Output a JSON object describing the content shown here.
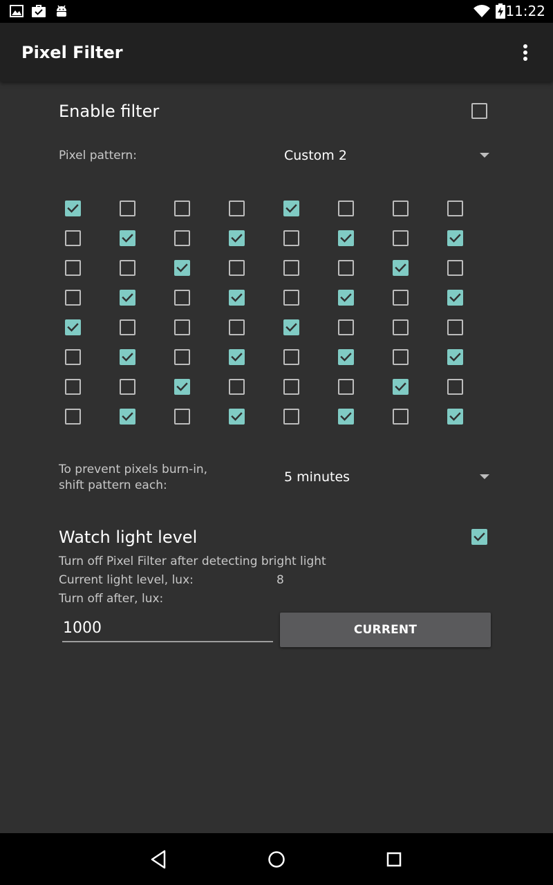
{
  "status_bar": {
    "time": "11:22",
    "left_icons": [
      "image-icon",
      "briefcase-check-icon",
      "android-icon"
    ],
    "right_icons": [
      "wifi-icon",
      "battery-charging-icon"
    ]
  },
  "app_bar": {
    "title": "Pixel Filter",
    "overflow_icon": "more-vert-icon"
  },
  "enable_filter": {
    "label": "Enable filter",
    "checked": false
  },
  "pixel_pattern": {
    "label": "Pixel pattern:",
    "selected": "Custom 2"
  },
  "pattern_grid": [
    [
      true,
      false,
      false,
      false,
      true,
      false,
      false,
      false
    ],
    [
      false,
      true,
      false,
      true,
      false,
      true,
      false,
      true
    ],
    [
      false,
      false,
      true,
      false,
      false,
      false,
      true,
      false
    ],
    [
      false,
      true,
      false,
      true,
      false,
      true,
      false,
      true
    ],
    [
      true,
      false,
      false,
      false,
      true,
      false,
      false,
      false
    ],
    [
      false,
      true,
      false,
      true,
      false,
      true,
      false,
      true
    ],
    [
      false,
      false,
      true,
      false,
      false,
      false,
      true,
      false
    ],
    [
      false,
      true,
      false,
      true,
      false,
      true,
      false,
      true
    ]
  ],
  "shift_pattern": {
    "label_line1": "To prevent pixels burn-in,",
    "label_line2": "shift pattern each:",
    "selected": "5 minutes"
  },
  "watch_light": {
    "label": "Watch light level",
    "checked": true,
    "description": "Turn off Pixel Filter after detecting bright light",
    "current_label": "Current light level, lux:",
    "current_value": "8",
    "turn_off_label": "Turn off after, lux:",
    "turn_off_value": "1000",
    "current_button": "CURRENT"
  },
  "colors": {
    "accent": "#80cbc4",
    "background": "#303030",
    "app_bar": "#212121",
    "button": "#5a5a5c"
  },
  "nav_bar": {
    "icons": [
      "back-icon",
      "home-icon",
      "recents-icon"
    ]
  }
}
